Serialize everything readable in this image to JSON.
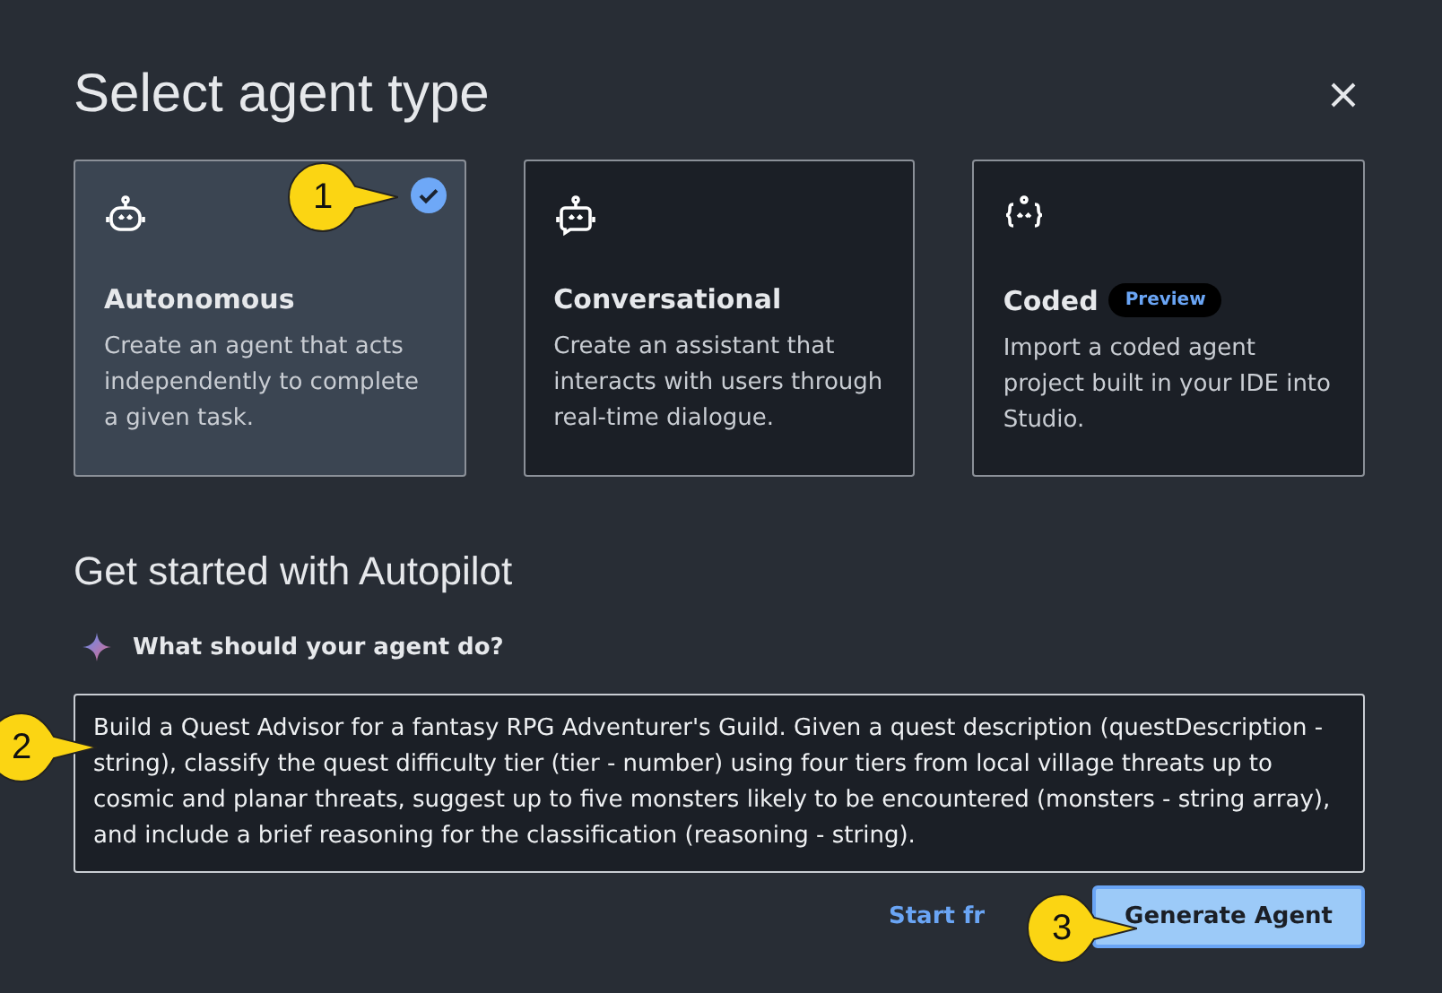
{
  "dialog": {
    "title": "Select agent type"
  },
  "agent_types": [
    {
      "kind": "autonomous",
      "title": "Autonomous",
      "description": "Create an agent that acts independently to complete a given task.",
      "selected": true
    },
    {
      "kind": "conversational",
      "title": "Conversational",
      "description": "Create an assistant that interacts with users through real-time dialogue.",
      "selected": false
    },
    {
      "kind": "coded",
      "title": "Coded",
      "badge": "Preview",
      "description": "Import a coded agent project built in your IDE into Studio.",
      "selected": false
    }
  ],
  "autopilot": {
    "heading": "Get started with Autopilot",
    "prompt_label": "What should your agent do?",
    "prompt_value": "Build a Quest Advisor for a fantasy RPG Adventurer's Guild. Given a quest description (questDescription - string), classify the quest difficulty tier (tier - number) using four tiers from local village threats up to cosmic and planar threats, suggest up to five monsters likely to be encountered (monsters - string array), and include a brief reasoning for the classification (reasoning - string)."
  },
  "footer": {
    "link": "Start fr",
    "button": "Generate Agent"
  },
  "callouts": [
    "1",
    "2",
    "3"
  ]
}
